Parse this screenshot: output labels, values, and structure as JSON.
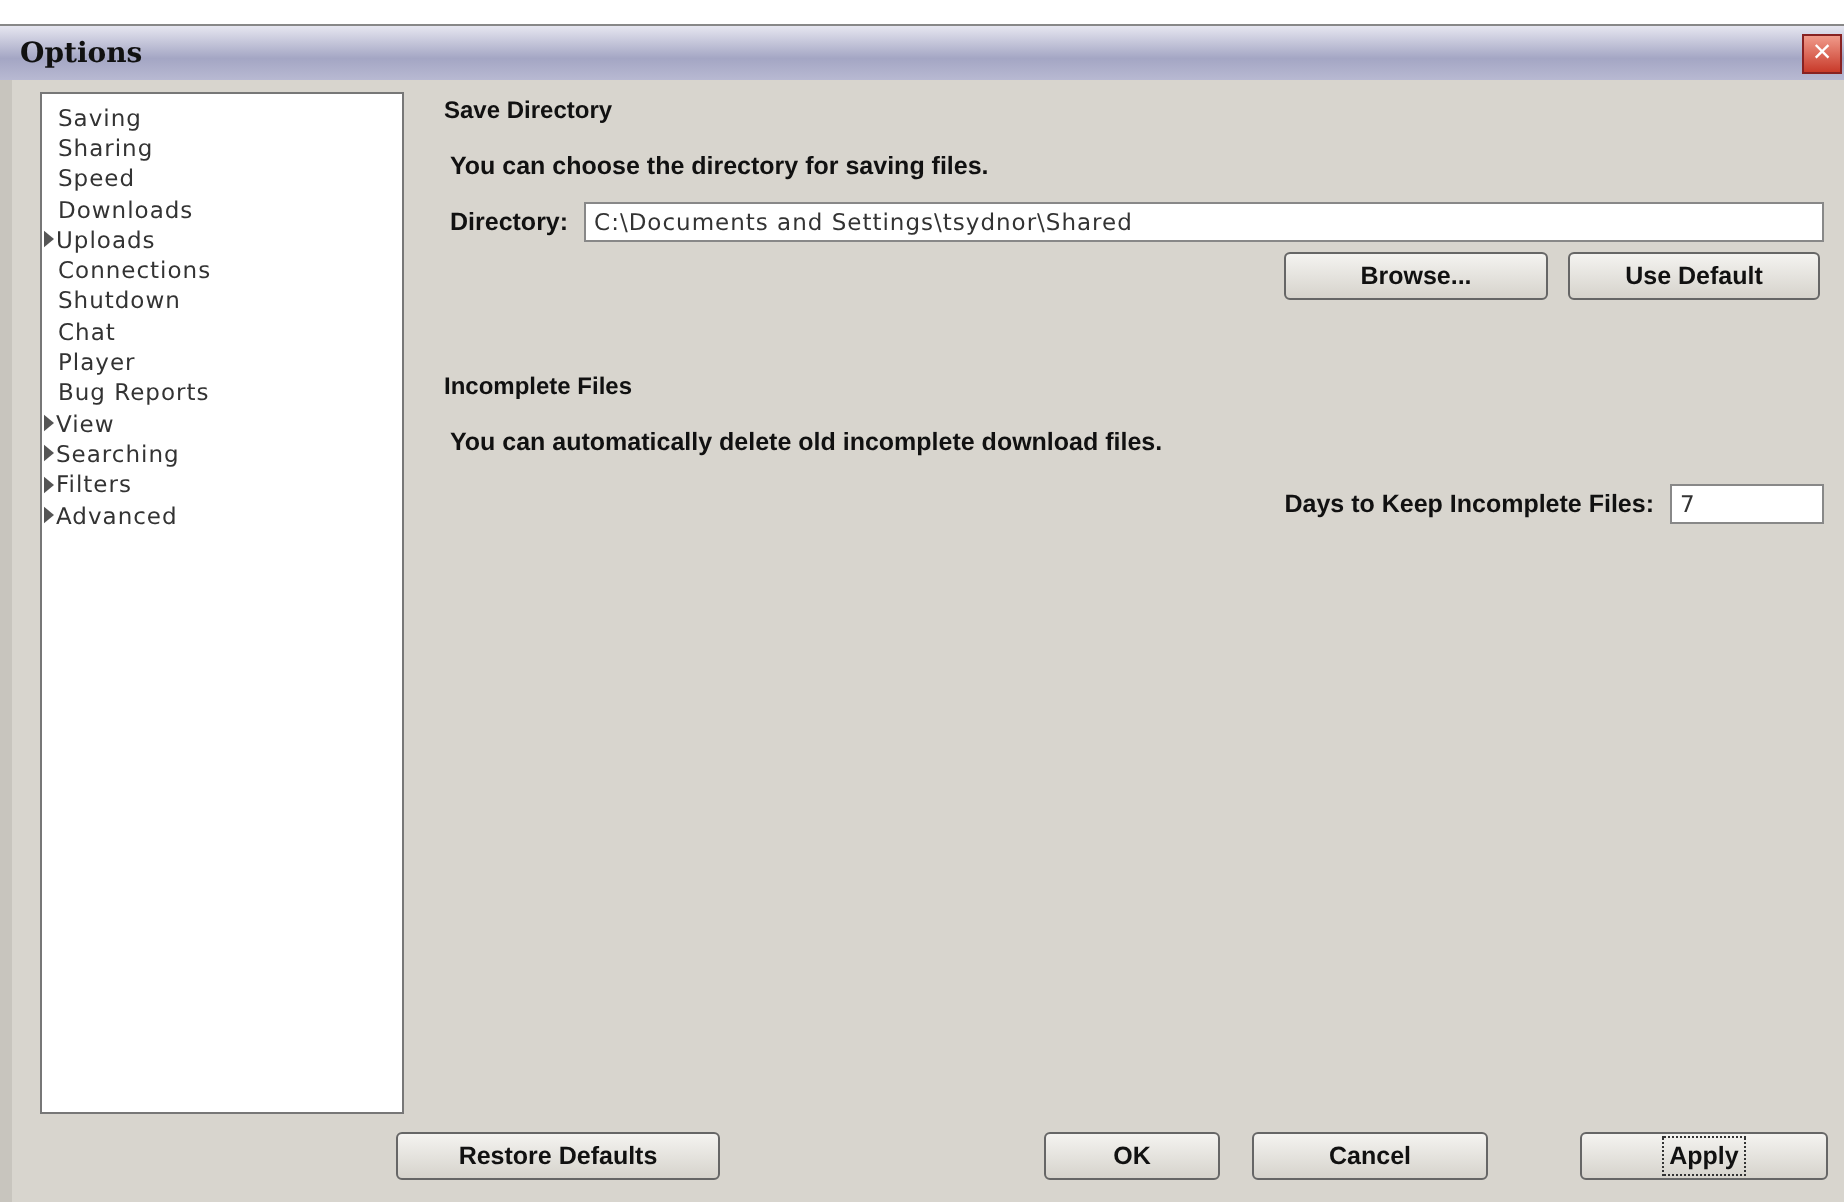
{
  "window": {
    "title": "Options",
    "close": "×"
  },
  "sidebar": {
    "items": [
      {
        "label": "Saving",
        "kind": "leaf"
      },
      {
        "label": "Sharing",
        "kind": "leaf"
      },
      {
        "label": "Speed",
        "kind": "leaf"
      },
      {
        "label": "Downloads",
        "kind": "leaf"
      },
      {
        "label": "Uploads",
        "kind": "branch"
      },
      {
        "label": "Connections",
        "kind": "leaf"
      },
      {
        "label": "Shutdown",
        "kind": "leaf"
      },
      {
        "label": "Chat",
        "kind": "leaf"
      },
      {
        "label": "Player",
        "kind": "leaf"
      },
      {
        "label": "Bug Reports",
        "kind": "leaf"
      },
      {
        "label": "View",
        "kind": "branch"
      },
      {
        "label": "Searching",
        "kind": "branch"
      },
      {
        "label": "Filters",
        "kind": "branch"
      },
      {
        "label": "Advanced",
        "kind": "branch"
      }
    ]
  },
  "save_directory": {
    "heading": "Save Directory",
    "description": "You can choose the directory for saving files.",
    "directory_label": "Directory:",
    "directory_value": "C:\\Documents and Settings\\tsydnor\\Shared",
    "buttons": [
      "Browse...",
      "Use Default"
    ]
  },
  "incomplete_files": {
    "heading": "Incomplete Files",
    "description": "You can automatically delete old incomplete download files.",
    "days_label": "Days to Keep Incomplete Files:",
    "days_value": "7"
  },
  "footer": {
    "restore": "Restore Defaults",
    "buttons": [
      {
        "label": "OK",
        "focused": false
      },
      {
        "label": "Cancel",
        "focused": false
      },
      {
        "label": "Apply",
        "focused": true
      }
    ]
  }
}
